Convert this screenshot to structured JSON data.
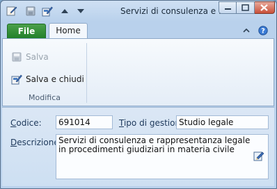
{
  "window": {
    "title": "Servizi di consulenza e ...",
    "quick_access": [
      "app-icon",
      "save-icon",
      "save-close-icon",
      "arrow-up-icon",
      "arrow-down-icon"
    ]
  },
  "ribbon": {
    "tabs": [
      {
        "label": "File",
        "accent": "#2a8a30"
      },
      {
        "label": "Home",
        "active": true
      }
    ],
    "buttons": {
      "save": {
        "label": "Salva",
        "enabled": false
      },
      "save_close": {
        "label": "Salva e chiudi",
        "enabled": true
      }
    },
    "group_label": "Modifica"
  },
  "form": {
    "code": {
      "label_underlined": "C",
      "label_rest": "odice:",
      "value": "691014"
    },
    "management_type": {
      "label_underlined": "T",
      "label_rest": "ipo di gestione:",
      "value": "Studio legale"
    },
    "description": {
      "label_underlined": "D",
      "label_rest": "escrizione:",
      "value": "Servizi di consulenza e rappresentanza legale in procedimenti giudiziari in materia civile"
    }
  }
}
